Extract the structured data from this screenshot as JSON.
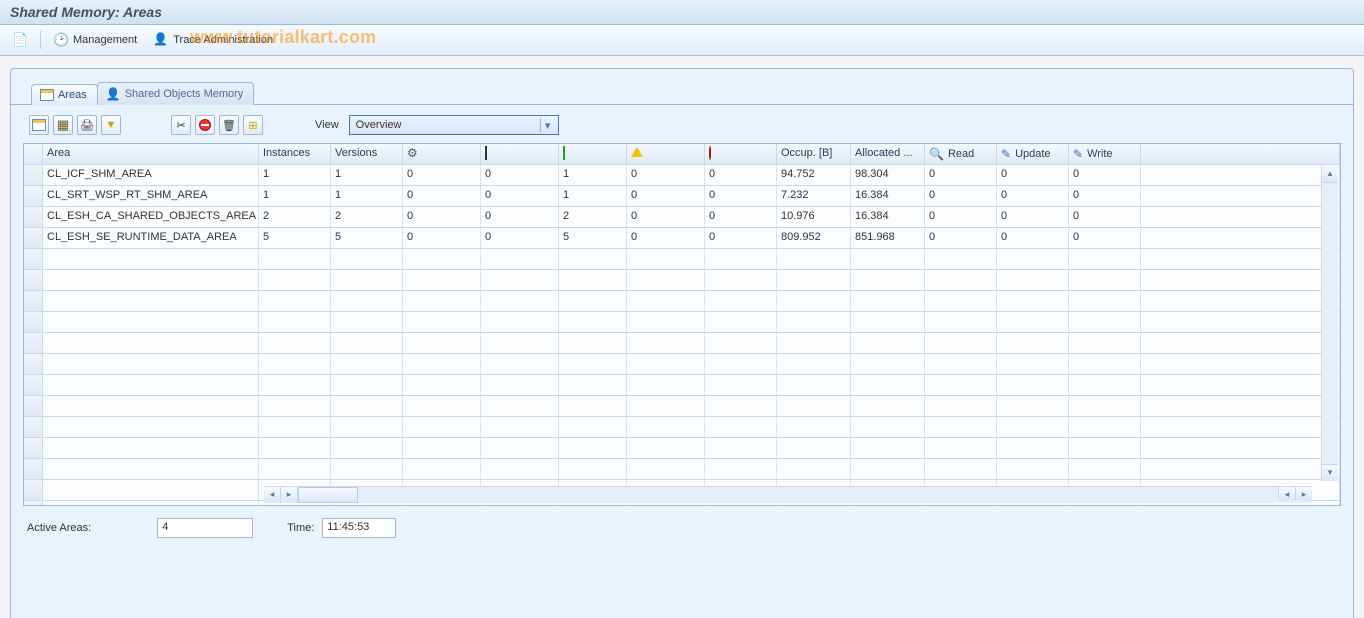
{
  "title": "Shared Memory: Areas",
  "watermark": "www.tutorialkart.com",
  "toolbar": {
    "management": "Management",
    "trace_admin": "Trace Administration"
  },
  "tabs": {
    "areas": "Areas",
    "shared_objects": "Shared Objects Memory"
  },
  "view": {
    "label": "View",
    "value": "Overview"
  },
  "columns": {
    "area": "Area",
    "instances": "Instances",
    "versions": "Versions",
    "occup": "Occup. [B]",
    "allocated": "Allocated ...",
    "read": "Read",
    "update": "Update",
    "write": "Write"
  },
  "rows": [
    {
      "area": "CL_ICF_SHM_AREA",
      "instances": "1",
      "versions": "1",
      "c1": "0",
      "c2": "0",
      "c3": "1",
      "c4": "0",
      "c5": "0",
      "occup": "94.752",
      "alloc": "98.304",
      "read": "0",
      "update": "0",
      "write": "0"
    },
    {
      "area": "CL_SRT_WSP_RT_SHM_AREA",
      "instances": "1",
      "versions": "1",
      "c1": "0",
      "c2": "0",
      "c3": "1",
      "c4": "0",
      "c5": "0",
      "occup": "7.232",
      "alloc": "16.384",
      "read": "0",
      "update": "0",
      "write": "0"
    },
    {
      "area": "CL_ESH_CA_SHARED_OBJECTS_AREA",
      "instances": "2",
      "versions": "2",
      "c1": "0",
      "c2": "0",
      "c3": "2",
      "c4": "0",
      "c5": "0",
      "occup": "10.976",
      "alloc": "16.384",
      "read": "0",
      "update": "0",
      "write": "0"
    },
    {
      "area": "CL_ESH_SE_RUNTIME_DATA_AREA",
      "instances": "5",
      "versions": "5",
      "c1": "0",
      "c2": "0",
      "c3": "5",
      "c4": "0",
      "c5": "0",
      "occup": "809.952",
      "alloc": "851.968",
      "read": "0",
      "update": "0",
      "write": "0"
    }
  ],
  "empty_rows": 13,
  "status": {
    "active_areas_label": "Active Areas:",
    "active_areas_value": "4",
    "time_label": "Time:",
    "time_value": "11:45:53"
  }
}
